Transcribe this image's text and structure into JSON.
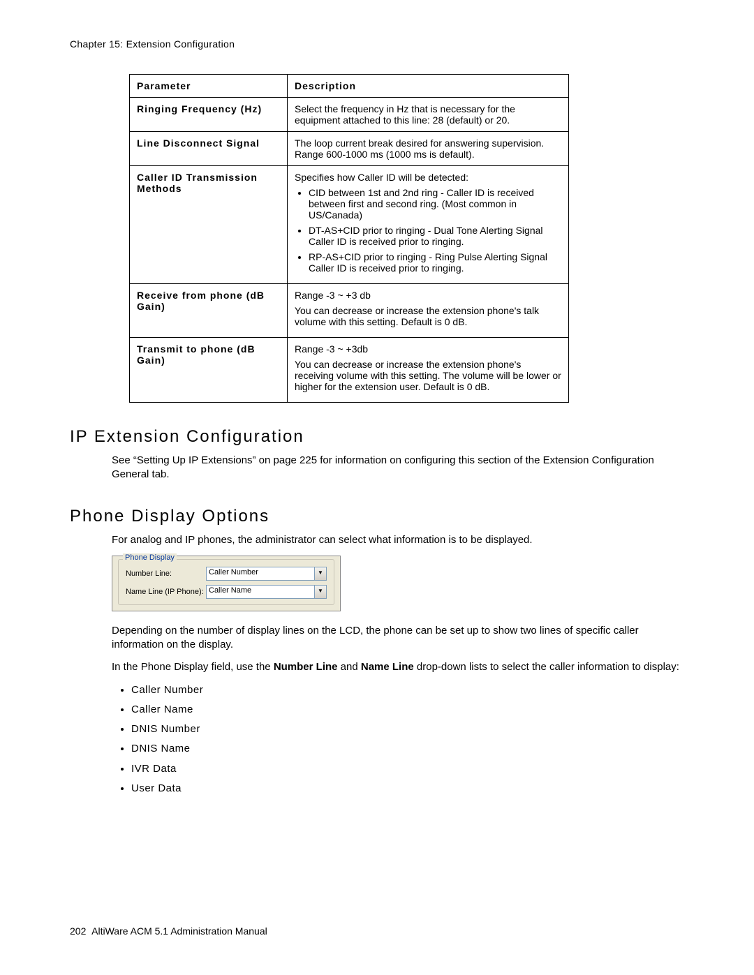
{
  "chapter": "Chapter 15:  Extension Configuration",
  "table": {
    "head": {
      "param": "Parameter",
      "desc": "Description"
    },
    "rows": [
      {
        "param": "Ringing Frequency (Hz)",
        "desc_plain": "Select the frequency in Hz that is necessary for the equipment attached to this line: 28 (default) or 20."
      },
      {
        "param": "Line Disconnect Signal",
        "desc_plain": "The loop current break desired for answering supervision. Range 600-1000 ms (1000 ms is default)."
      },
      {
        "param": "Caller ID Transmission Methods",
        "desc_intro": "Specifies how Caller ID will be detected:",
        "bullets": [
          "CID between 1st and 2nd ring - Caller ID is received between first and second ring. (Most common in US/Canada)",
          "DT-AS+CID prior to ringing - Dual Tone Alerting Signal Caller ID is received prior to ringing.",
          "RP-AS+CID prior to ringing - Ring Pulse Alerting Signal Caller ID is received prior to ringing."
        ]
      },
      {
        "param": "Receive from phone (dB Gain)",
        "desc_line1": "Range -3 ~ +3 db",
        "desc_line2": "You can decrease or increase the extension phone's talk volume with this setting. Default is 0 dB."
      },
      {
        "param": "Transmit to phone (dB Gain)",
        "desc_line1": "Range -3 ~ +3db",
        "desc_line2": "You can decrease or increase the extension phone's receiving volume with this setting. The volume will be lower or higher for the extension user. Default is 0 dB."
      }
    ]
  },
  "section1": {
    "title": "IP Extension Configuration",
    "para": "See “Setting Up IP Extensions” on page 225 for information on configuring this section of the Extension Configuration General tab."
  },
  "section2": {
    "title": "Phone Display Options",
    "para1": "For analog and IP phones, the administrator can select what information is to be displayed.",
    "screenshot": {
      "group": "Phone Display",
      "row1_label": "Number Line:",
      "row1_value": "Caller Number",
      "row2_label": "Name Line (IP Phone):",
      "row2_value": "Caller Name"
    },
    "para2": "Depending on the number of display lines on the LCD, the phone can be set up to show two lines of specific caller information on the display.",
    "para3_pre": "In the Phone Display field, use the ",
    "para3_b1": "Number Line",
    "para3_mid": " and ",
    "para3_b2": "Name Line",
    "para3_post": " drop-down lists to select the caller information to display:",
    "list": [
      "Caller Number",
      "Caller Name",
      "DNIS Number",
      "DNIS Name",
      "IVR Data",
      "User Data"
    ]
  },
  "footer": {
    "page": "202",
    "title": "AltiWare ACM 5.1 Administration Manual"
  }
}
